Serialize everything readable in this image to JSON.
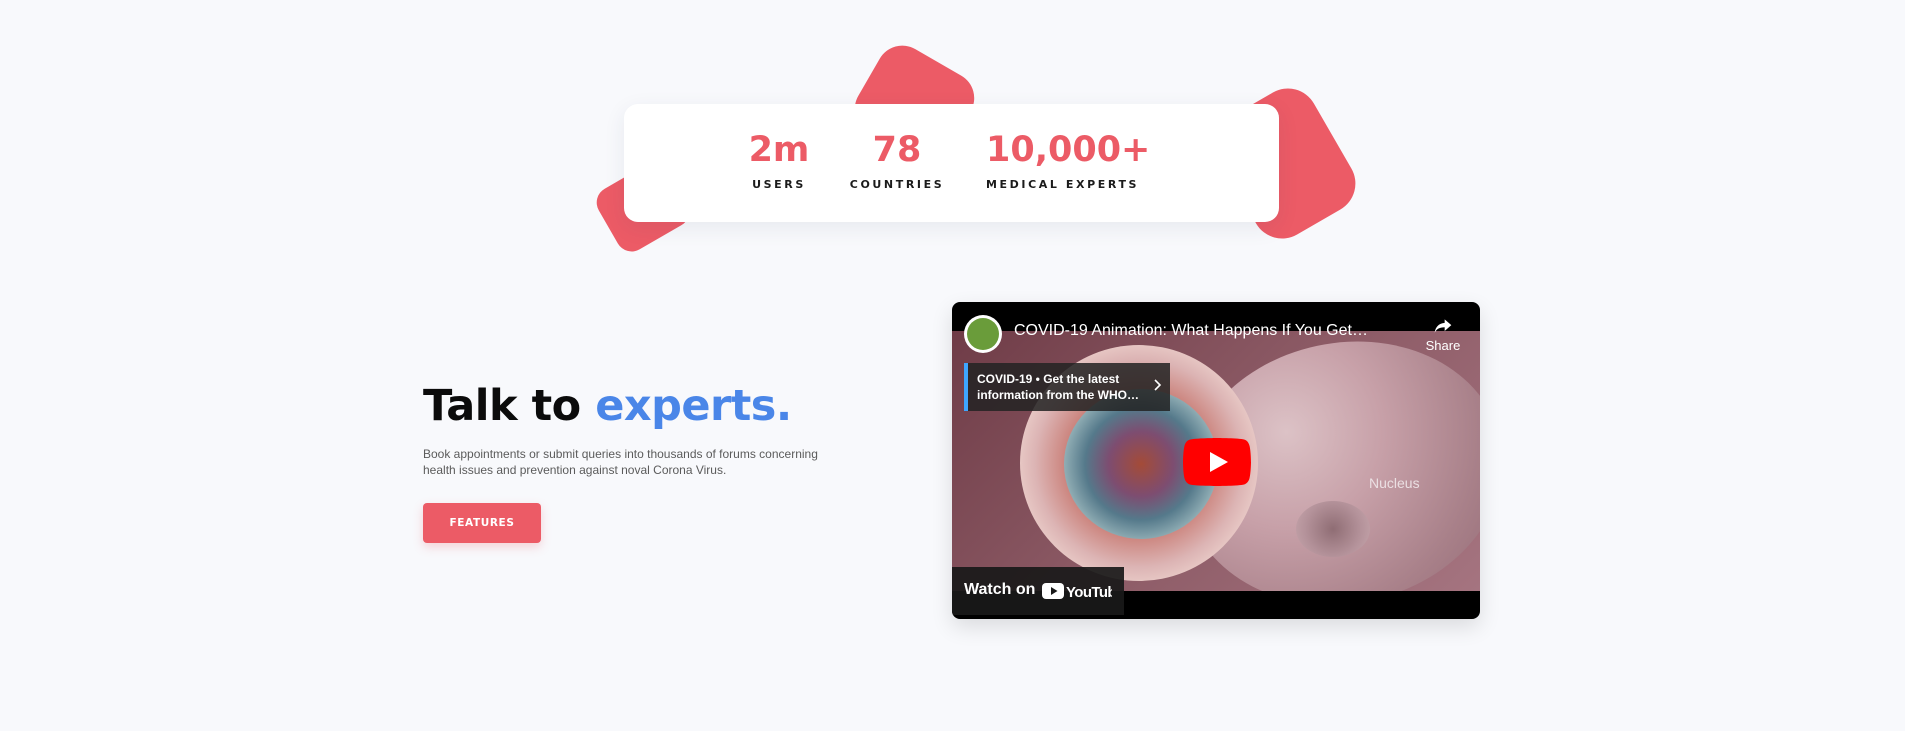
{
  "colors": {
    "accent": "#ec5b66",
    "highlight": "#4a86e8",
    "background": "#f8f9fc",
    "youtube_red": "#ff0000"
  },
  "stats": [
    {
      "value": "2m",
      "label": "USERS"
    },
    {
      "value": "78",
      "label": "COUNTRIES"
    },
    {
      "value": "10,000+",
      "label": "MEDICAL EXPERTS"
    }
  ],
  "hero": {
    "title_part1": "Talk to ",
    "title_accent": "experts.",
    "description": "Book appointments or submit queries into thousands of forums concerning health issues and prevention against noval Corona Virus.",
    "button_label": "FEATURES"
  },
  "video": {
    "title": "COVID-19 Animation: What Happens If You Get…",
    "share_label": "Share",
    "info_card_text": "COVID-19 • Get the latest information from the WHO…",
    "scene_label": "Nucleus",
    "watch_label": "Watch on",
    "brand_label": "YouTube",
    "icons": [
      "channel-avatar",
      "share-icon",
      "chevron-right-icon",
      "play-icon",
      "youtube-logo"
    ]
  }
}
